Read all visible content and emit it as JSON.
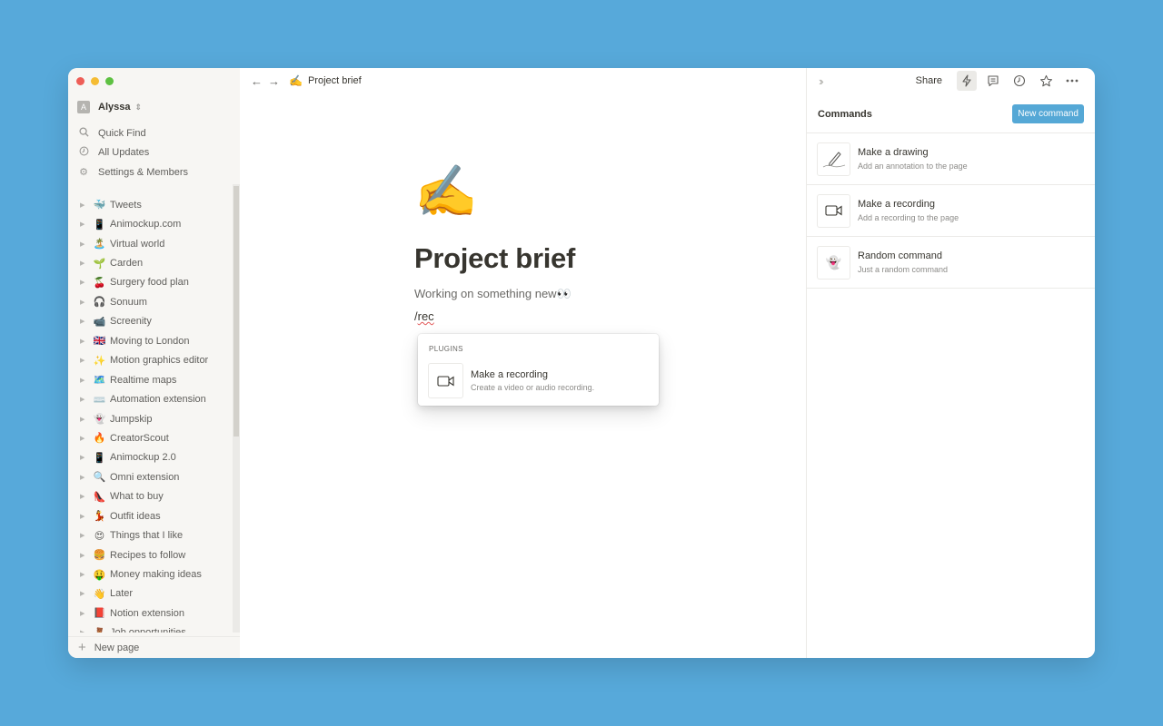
{
  "window": {
    "traffic_lights": {
      "close": "#ee5e57",
      "minimize": "#f5bc33",
      "maximize": "#5ec142"
    }
  },
  "sidebar": {
    "workspace": {
      "avatar_letter": "A",
      "name": "Alyssa"
    },
    "menu": [
      {
        "icon": "search-icon",
        "label": "Quick Find"
      },
      {
        "icon": "clock-icon",
        "label": "All Updates"
      },
      {
        "icon": "gear-icon",
        "label": "Settings & Members"
      }
    ],
    "pages": [
      {
        "emoji": "🐳",
        "label": "Tweets"
      },
      {
        "emoji": "📱",
        "label": "Animockup.com"
      },
      {
        "emoji": "🏝️",
        "label": "Virtual world"
      },
      {
        "emoji": "🌱",
        "label": "Carden"
      },
      {
        "emoji": "🍒",
        "label": "Surgery food plan"
      },
      {
        "emoji": "🎧",
        "label": "Sonuum"
      },
      {
        "emoji": "📹",
        "label": "Screenity"
      },
      {
        "emoji": "🇬🇧",
        "label": "Moving to London"
      },
      {
        "emoji": "✨",
        "label": "Motion graphics editor"
      },
      {
        "emoji": "🗺️",
        "label": "Realtime maps"
      },
      {
        "emoji": "⌨️",
        "label": "Automation extension"
      },
      {
        "emoji": "👻",
        "label": "Jumpskip"
      },
      {
        "emoji": "🔥",
        "label": "CreatorScout"
      },
      {
        "emoji": "📱",
        "label": "Animockup 2.0"
      },
      {
        "emoji": "🔍",
        "label": "Omni extension"
      },
      {
        "emoji": "👠",
        "label": "What to buy"
      },
      {
        "emoji": "💃",
        "label": "Outfit ideas"
      },
      {
        "emoji": "😍",
        "label": "Things that I like"
      },
      {
        "emoji": "🍔",
        "label": "Recipes to follow"
      },
      {
        "emoji": "🤑",
        "label": "Money making ideas"
      },
      {
        "emoji": "👋",
        "label": "Later"
      },
      {
        "emoji": "📕",
        "label": "Notion extension"
      },
      {
        "emoji": "🧸",
        "label": "Job opportunities"
      }
    ],
    "new_page_label": "New page"
  },
  "topbar": {
    "breadcrumb_emoji": "✍️",
    "breadcrumb_title": "Project brief"
  },
  "document": {
    "icon": "✍️",
    "title": "Project brief",
    "subtitle": "Working on something new👀",
    "command_slash": "/",
    "command_text": "rec"
  },
  "slash_menu": {
    "section_label": "PLUGINS",
    "items": [
      {
        "icon": "video-camera-icon",
        "title": "Make a recording",
        "description": "Create a video or audio recording."
      }
    ]
  },
  "right_panel": {
    "share_label": "Share",
    "title": "Commands",
    "new_command_label": "New command",
    "accent_color": "#55a8d6",
    "commands": [
      {
        "icon": "pencil-drawing-icon",
        "title": "Make a drawing",
        "description": "Add an annotation to the page"
      },
      {
        "icon": "video-camera-icon",
        "title": "Make a recording",
        "description": "Add a recording to the page"
      },
      {
        "icon": "ghost-icon",
        "emoji": "👻",
        "title": "Random command",
        "description": "Just a random command"
      }
    ]
  }
}
